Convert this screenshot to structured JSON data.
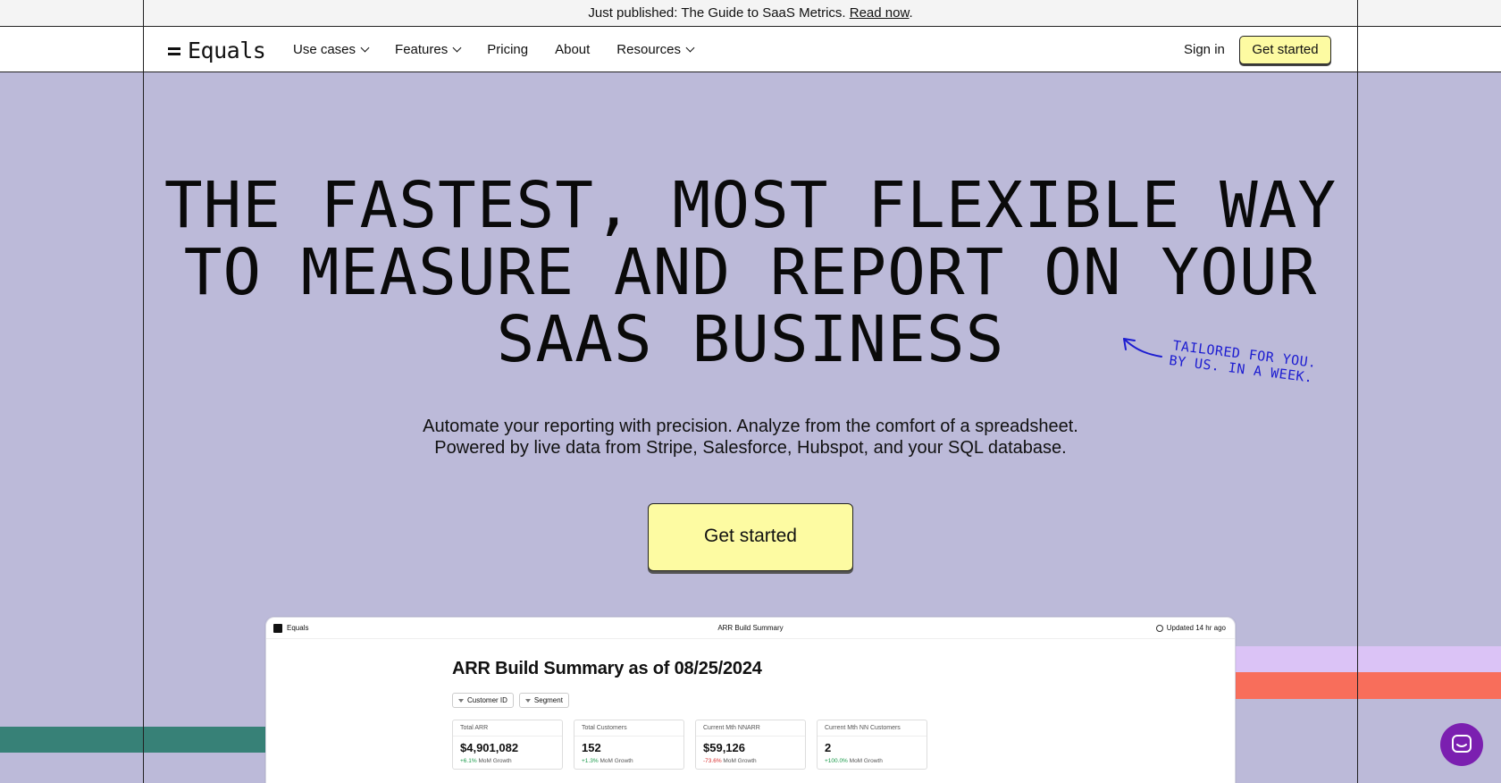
{
  "announcement": {
    "prefix": "Just published: The Guide to SaaS Metrics.",
    "link": "Read now",
    "suffix": "."
  },
  "nav": {
    "logo": "Equals",
    "items": [
      {
        "label": "Use cases",
        "dropdown": true
      },
      {
        "label": "Features",
        "dropdown": true
      },
      {
        "label": "Pricing",
        "dropdown": false
      },
      {
        "label": "About",
        "dropdown": false
      },
      {
        "label": "Resources",
        "dropdown": true
      }
    ],
    "sign_in": "Sign in",
    "cta": "Get started"
  },
  "hero": {
    "title_lines": [
      "THE FASTEST, MOST FLEXIBLE WAY",
      "TO MEASURE AND REPORT ON YOUR",
      "SAAS BUSINESS"
    ],
    "note_lines": [
      "TAILORED FOR YOU.",
      "BY US. IN A WEEK."
    ],
    "subtitle_lines": [
      "Automate your reporting with precision. Analyze from the comfort of a spreadsheet.",
      "Powered by live data from Stripe, Salesforce, Hubspot, and your SQL database."
    ],
    "cta": "Get started"
  },
  "preview": {
    "brand": "Equals",
    "title": "ARR Build Summary",
    "updated": "Updated 14 hr ago",
    "heading": "ARR Build Summary as of 08/25/2024",
    "filters": [
      "Customer ID",
      "Segment"
    ],
    "cards": [
      {
        "label": "Total ARR",
        "value": "$4,901,082",
        "delta": "+6.1%",
        "delta_dir": "up",
        "delta_label": "MoM Growth"
      },
      {
        "label": "Total Customers",
        "value": "152",
        "delta": "+1.3%",
        "delta_dir": "up",
        "delta_label": "MoM Growth"
      },
      {
        "label": "Current Mth NNARR",
        "value": "$59,126",
        "delta": "-73.6%",
        "delta_dir": "down",
        "delta_label": "MoM Growth"
      },
      {
        "label": "Current Mth NN Customers",
        "value": "2",
        "delta": "+100.0%",
        "delta_dir": "up",
        "delta_label": "MoM Growth"
      }
    ]
  },
  "colors": {
    "background": "#bcbad9",
    "cta": "#fdfba2",
    "note": "#1d1dd1",
    "stripe_teal": "#378177",
    "stripe_lilac": "#dbc3f6",
    "stripe_coral": "#f86e5b",
    "chat": "#7b1fb0"
  },
  "icons": {
    "chat": "chat-bubble-icon",
    "clock": "clock-icon",
    "filter": "filter-icon",
    "chevron": "chevron-down-icon"
  }
}
